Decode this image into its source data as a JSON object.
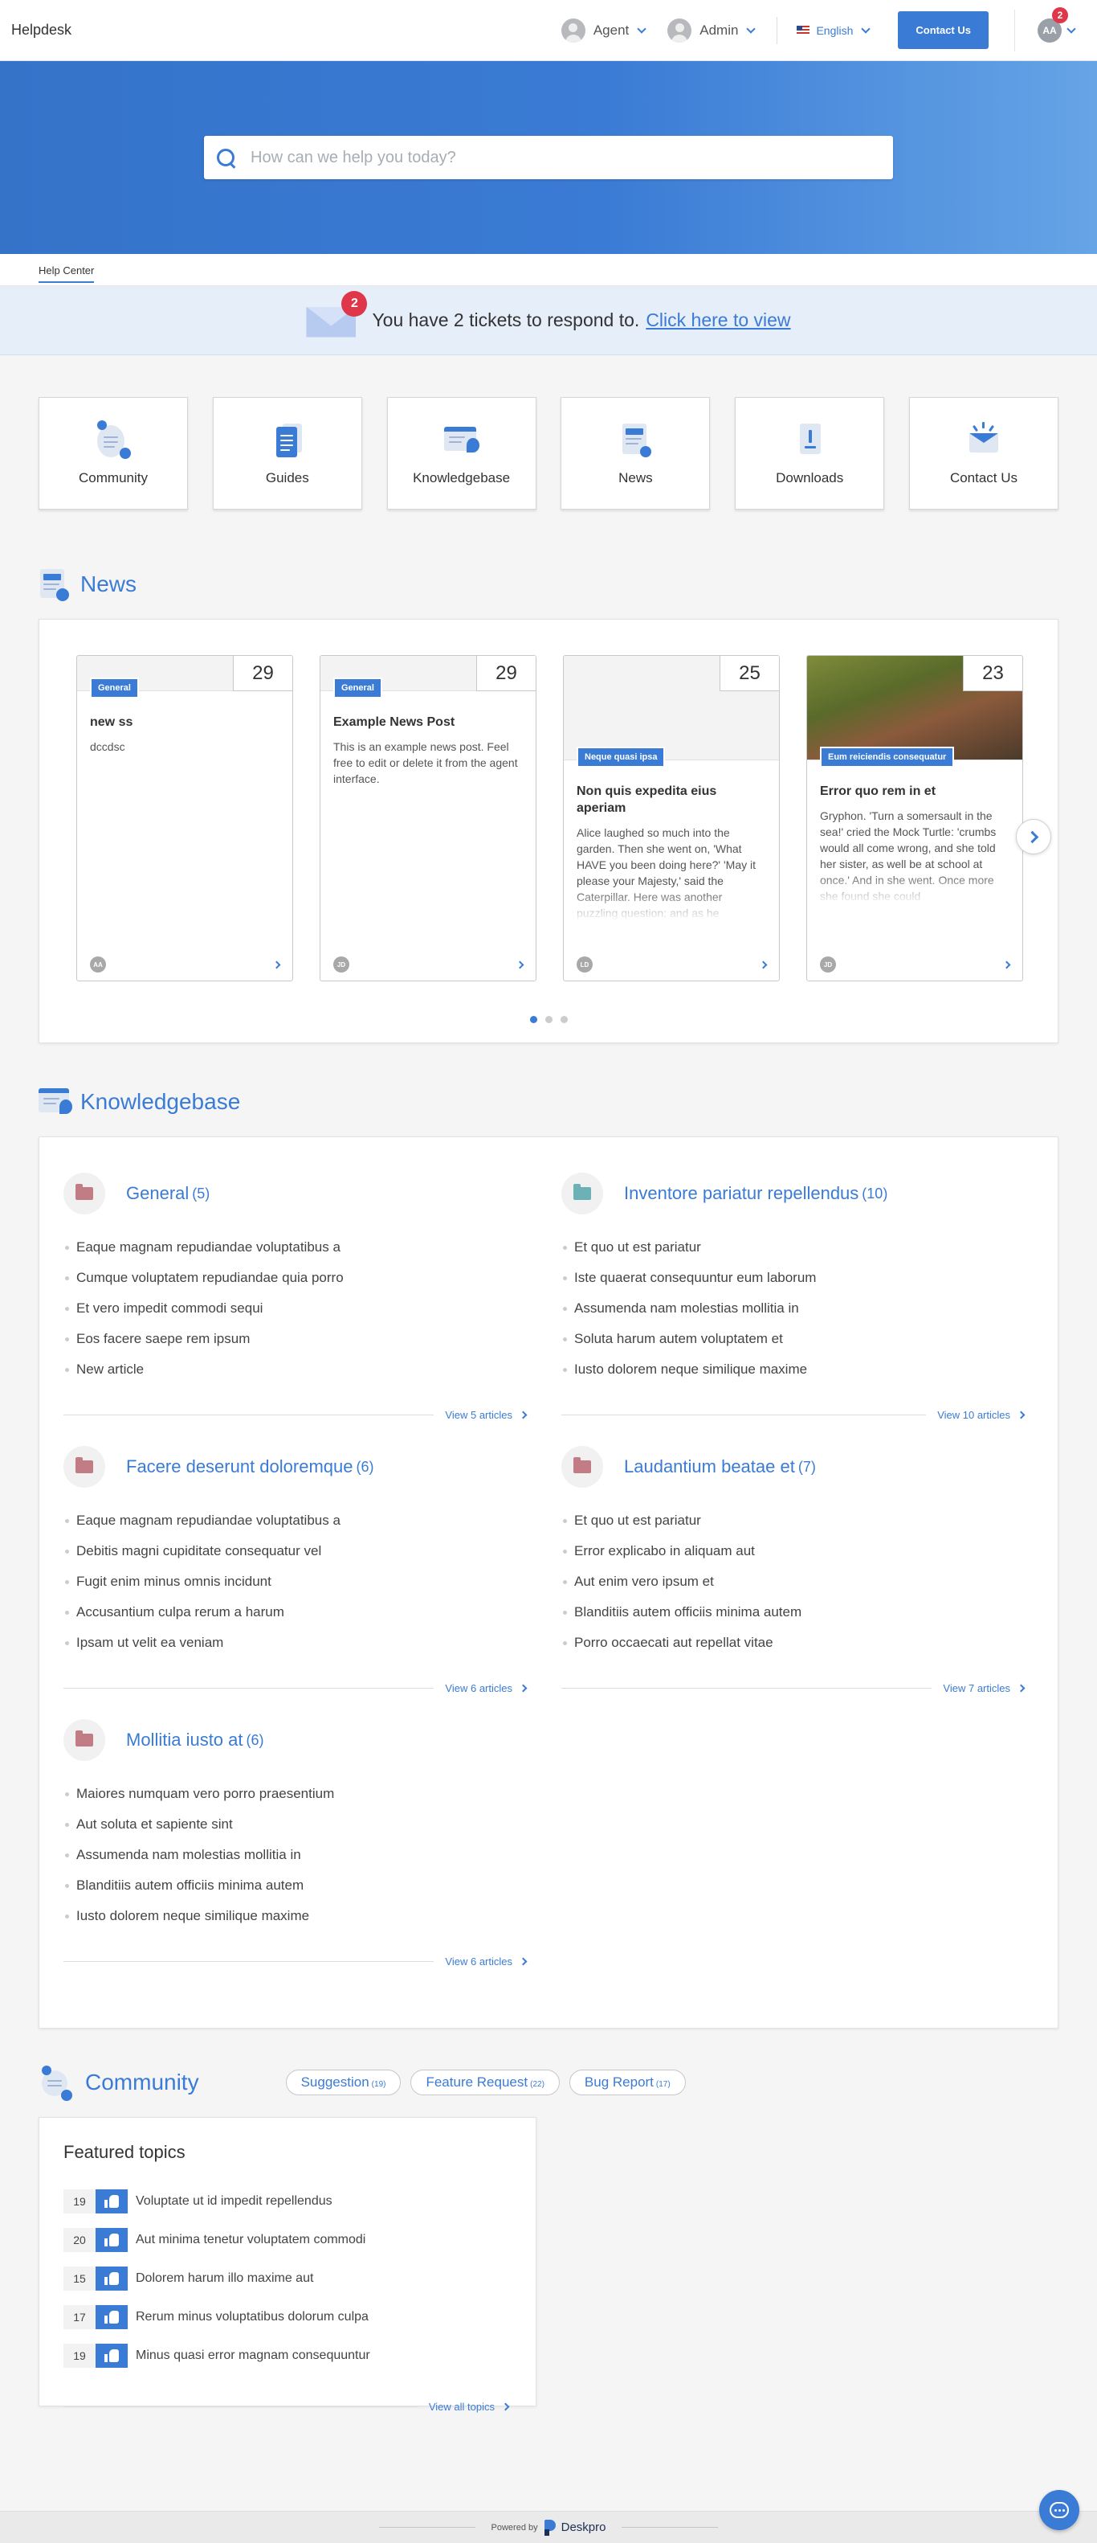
{
  "header": {
    "brand": "Helpdesk",
    "agent_label": "Agent",
    "admin_label": "Admin",
    "language": "English",
    "contact_button": "Contact Us",
    "user_initials": "AA",
    "notification_count": "2"
  },
  "search": {
    "placeholder": "How can we help you today?"
  },
  "breadcrumb": {
    "label": "Help Center"
  },
  "tickets_banner": {
    "count": "2",
    "text": "You have 2 tickets to respond to.",
    "link": "Click here to view"
  },
  "nav_cards": [
    {
      "label": "Community",
      "icon": "community-icon"
    },
    {
      "label": "Guides",
      "icon": "guides-icon"
    },
    {
      "label": "Knowledgebase",
      "icon": "knowledgebase-icon"
    },
    {
      "label": "News",
      "icon": "news-icon"
    },
    {
      "label": "Downloads",
      "icon": "downloads-icon"
    },
    {
      "label": "Contact Us",
      "icon": "contact-icon"
    }
  ],
  "news": {
    "title": "News",
    "items": [
      {
        "day": "29",
        "category": "General",
        "title": "new ss",
        "text": "dccdsc",
        "author": "AA"
      },
      {
        "day": "29",
        "category": "General",
        "title": "Example News Post",
        "text": "This is an example news post. Feel free to edit or delete it from the agent interface.",
        "author": "JD"
      },
      {
        "day": "25",
        "category": "Neque quasi ipsa",
        "title": "Non quis expedita eius aperiam",
        "text": "Alice laughed so much into the garden. Then she went on, 'What HAVE you been doing here?' 'May it please your Majesty,' said the Caterpillar. Here was another puzzling question; and as he",
        "author": "LD"
      },
      {
        "day": "23",
        "category": "Eum reiciendis consequatur",
        "title": "Error quo rem in et",
        "text": "Gryphon. 'Turn a somersault in the sea!' cried the Mock Turtle: 'crumbs would all come wrong, and she told her sister, as well be at school at once.' And in she went. Once more she found she could",
        "author": "JD"
      }
    ],
    "pages": 3,
    "active_page": 1
  },
  "knowledgebase": {
    "title": "Knowledgebase",
    "categories": [
      {
        "name": "General",
        "count": "(5)",
        "folder_color": "#c27d84",
        "articles": [
          "Eaque magnam repudiandae voluptatibus a",
          "Cumque voluptatem repudiandae quia porro",
          "Et vero impedit commodi sequi",
          "Eos facere saepe rem ipsum",
          "New article"
        ],
        "view_all": "View 5 articles"
      },
      {
        "name": "Inventore pariatur repellendus",
        "count": "(10)",
        "folder_color": "#6bb1b6",
        "articles": [
          "Et quo ut est pariatur",
          "Iste quaerat consequuntur eum laborum",
          "Assumenda nam molestias mollitia in",
          "Soluta harum autem voluptatem et",
          "Iusto dolorem neque similique maxime"
        ],
        "view_all": "View 10 articles"
      },
      {
        "name": "Facere deserunt doloremque",
        "count": "(6)",
        "folder_color": "#c27d84",
        "articles": [
          "Eaque magnam repudiandae voluptatibus a",
          "Debitis magni cupiditate consequatur vel",
          "Fugit enim minus omnis incidunt",
          "Accusantium culpa rerum a harum",
          "Ipsam ut velit ea veniam"
        ],
        "view_all": "View 6 articles"
      },
      {
        "name": "Laudantium beatae et",
        "count": "(7)",
        "folder_color": "#c27d84",
        "articles": [
          "Et quo ut est pariatur",
          "Error explicabo in aliquam aut",
          "Aut enim vero ipsum et",
          "Blanditiis autem officiis minima autem",
          "Porro occaecati aut repellat vitae"
        ],
        "view_all": "View 7 articles"
      },
      {
        "name": "Mollitia iusto at",
        "count": "(6)",
        "folder_color": "#c27d84",
        "articles": [
          "Maiores numquam vero porro praesentium",
          "Aut soluta et sapiente sint",
          "Assumenda nam molestias mollitia in",
          "Blanditiis autem officiis minima autem",
          "Iusto dolorem neque similique maxime"
        ],
        "view_all": "View 6 articles"
      }
    ]
  },
  "community": {
    "title": "Community",
    "filters": [
      {
        "label": "Suggestion",
        "count": "(19)"
      },
      {
        "label": "Feature Request",
        "count": "(22)"
      },
      {
        "label": "Bug Report",
        "count": "(17)"
      }
    ],
    "featured_title": "Featured topics",
    "topics": [
      {
        "votes": "19",
        "title": "Voluptate ut id impedit repellendus"
      },
      {
        "votes": "20",
        "title": "Aut minima tenetur voluptatem commodi"
      },
      {
        "votes": "15",
        "title": "Dolorem harum illo maxime aut"
      },
      {
        "votes": "17",
        "title": "Rerum minus voluptatibus dolorum culpa"
      },
      {
        "votes": "19",
        "title": "Minus quasi error magnam consequuntur"
      }
    ],
    "view_all": "View all topics"
  },
  "footer": {
    "powered_by": "Powered by",
    "product": "Deskpro"
  },
  "colors": {
    "accent": "#3a7bd5",
    "badge": "#e0364a"
  }
}
